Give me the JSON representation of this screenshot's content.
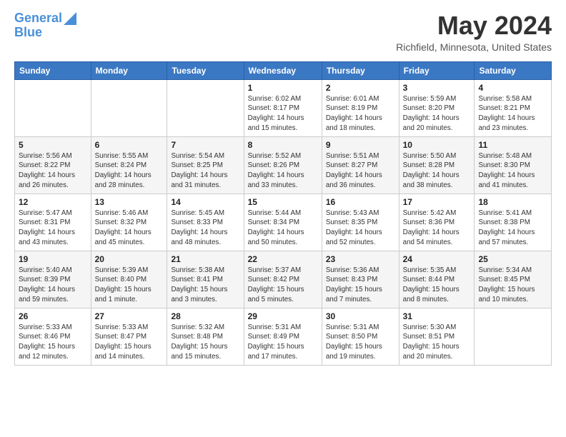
{
  "logo": {
    "line1": "General",
    "line2": "Blue"
  },
  "header": {
    "month_title": "May 2024",
    "location": "Richfield, Minnesota, United States"
  },
  "days_of_week": [
    "Sunday",
    "Monday",
    "Tuesday",
    "Wednesday",
    "Thursday",
    "Friday",
    "Saturday"
  ],
  "weeks": [
    [
      {
        "day": "",
        "info": ""
      },
      {
        "day": "",
        "info": ""
      },
      {
        "day": "",
        "info": ""
      },
      {
        "day": "1",
        "info": "Sunrise: 6:02 AM\nSunset: 8:17 PM\nDaylight: 14 hours\nand 15 minutes."
      },
      {
        "day": "2",
        "info": "Sunrise: 6:01 AM\nSunset: 8:19 PM\nDaylight: 14 hours\nand 18 minutes."
      },
      {
        "day": "3",
        "info": "Sunrise: 5:59 AM\nSunset: 8:20 PM\nDaylight: 14 hours\nand 20 minutes."
      },
      {
        "day": "4",
        "info": "Sunrise: 5:58 AM\nSunset: 8:21 PM\nDaylight: 14 hours\nand 23 minutes."
      }
    ],
    [
      {
        "day": "5",
        "info": "Sunrise: 5:56 AM\nSunset: 8:22 PM\nDaylight: 14 hours\nand 26 minutes."
      },
      {
        "day": "6",
        "info": "Sunrise: 5:55 AM\nSunset: 8:24 PM\nDaylight: 14 hours\nand 28 minutes."
      },
      {
        "day": "7",
        "info": "Sunrise: 5:54 AM\nSunset: 8:25 PM\nDaylight: 14 hours\nand 31 minutes."
      },
      {
        "day": "8",
        "info": "Sunrise: 5:52 AM\nSunset: 8:26 PM\nDaylight: 14 hours\nand 33 minutes."
      },
      {
        "day": "9",
        "info": "Sunrise: 5:51 AM\nSunset: 8:27 PM\nDaylight: 14 hours\nand 36 minutes."
      },
      {
        "day": "10",
        "info": "Sunrise: 5:50 AM\nSunset: 8:28 PM\nDaylight: 14 hours\nand 38 minutes."
      },
      {
        "day": "11",
        "info": "Sunrise: 5:48 AM\nSunset: 8:30 PM\nDaylight: 14 hours\nand 41 minutes."
      }
    ],
    [
      {
        "day": "12",
        "info": "Sunrise: 5:47 AM\nSunset: 8:31 PM\nDaylight: 14 hours\nand 43 minutes."
      },
      {
        "day": "13",
        "info": "Sunrise: 5:46 AM\nSunset: 8:32 PM\nDaylight: 14 hours\nand 45 minutes."
      },
      {
        "day": "14",
        "info": "Sunrise: 5:45 AM\nSunset: 8:33 PM\nDaylight: 14 hours\nand 48 minutes."
      },
      {
        "day": "15",
        "info": "Sunrise: 5:44 AM\nSunset: 8:34 PM\nDaylight: 14 hours\nand 50 minutes."
      },
      {
        "day": "16",
        "info": "Sunrise: 5:43 AM\nSunset: 8:35 PM\nDaylight: 14 hours\nand 52 minutes."
      },
      {
        "day": "17",
        "info": "Sunrise: 5:42 AM\nSunset: 8:36 PM\nDaylight: 14 hours\nand 54 minutes."
      },
      {
        "day": "18",
        "info": "Sunrise: 5:41 AM\nSunset: 8:38 PM\nDaylight: 14 hours\nand 57 minutes."
      }
    ],
    [
      {
        "day": "19",
        "info": "Sunrise: 5:40 AM\nSunset: 8:39 PM\nDaylight: 14 hours\nand 59 minutes."
      },
      {
        "day": "20",
        "info": "Sunrise: 5:39 AM\nSunset: 8:40 PM\nDaylight: 15 hours\nand 1 minute."
      },
      {
        "day": "21",
        "info": "Sunrise: 5:38 AM\nSunset: 8:41 PM\nDaylight: 15 hours\nand 3 minutes."
      },
      {
        "day": "22",
        "info": "Sunrise: 5:37 AM\nSunset: 8:42 PM\nDaylight: 15 hours\nand 5 minutes."
      },
      {
        "day": "23",
        "info": "Sunrise: 5:36 AM\nSunset: 8:43 PM\nDaylight: 15 hours\nand 7 minutes."
      },
      {
        "day": "24",
        "info": "Sunrise: 5:35 AM\nSunset: 8:44 PM\nDaylight: 15 hours\nand 8 minutes."
      },
      {
        "day": "25",
        "info": "Sunrise: 5:34 AM\nSunset: 8:45 PM\nDaylight: 15 hours\nand 10 minutes."
      }
    ],
    [
      {
        "day": "26",
        "info": "Sunrise: 5:33 AM\nSunset: 8:46 PM\nDaylight: 15 hours\nand 12 minutes."
      },
      {
        "day": "27",
        "info": "Sunrise: 5:33 AM\nSunset: 8:47 PM\nDaylight: 15 hours\nand 14 minutes."
      },
      {
        "day": "28",
        "info": "Sunrise: 5:32 AM\nSunset: 8:48 PM\nDaylight: 15 hours\nand 15 minutes."
      },
      {
        "day": "29",
        "info": "Sunrise: 5:31 AM\nSunset: 8:49 PM\nDaylight: 15 hours\nand 17 minutes."
      },
      {
        "day": "30",
        "info": "Sunrise: 5:31 AM\nSunset: 8:50 PM\nDaylight: 15 hours\nand 19 minutes."
      },
      {
        "day": "31",
        "info": "Sunrise: 5:30 AM\nSunset: 8:51 PM\nDaylight: 15 hours\nand 20 minutes."
      },
      {
        "day": "",
        "info": ""
      }
    ]
  ]
}
